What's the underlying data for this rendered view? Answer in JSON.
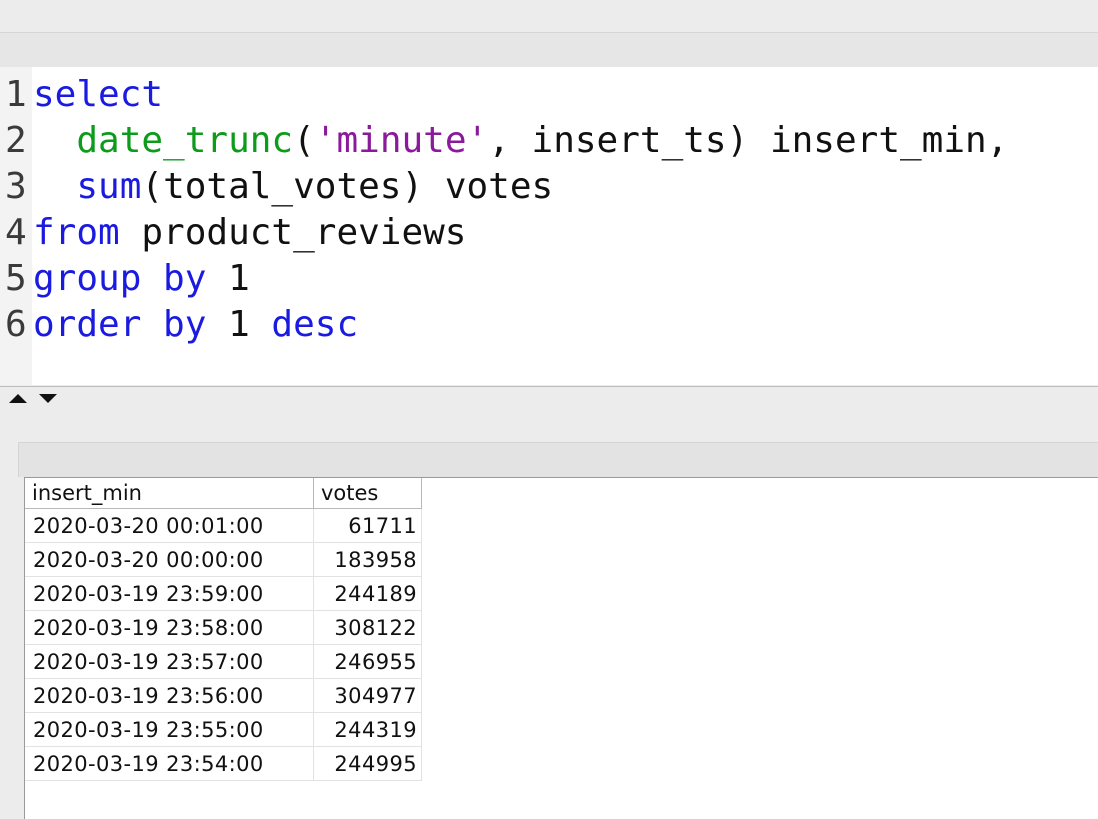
{
  "editor": {
    "lines": [
      {
        "num": "1",
        "tokens": [
          {
            "t": "select",
            "c": "kw"
          }
        ]
      },
      {
        "num": "2",
        "tokens": [
          {
            "t": "  ",
            "c": "plain"
          },
          {
            "t": "date_trunc",
            "c": "fn"
          },
          {
            "t": "(",
            "c": "plain"
          },
          {
            "t": "'minute'",
            "c": "str"
          },
          {
            "t": ", insert_ts) insert_min,",
            "c": "plain"
          }
        ]
      },
      {
        "num": "3",
        "tokens": [
          {
            "t": "  ",
            "c": "plain"
          },
          {
            "t": "sum",
            "c": "kw"
          },
          {
            "t": "(total_votes) votes",
            "c": "plain"
          }
        ]
      },
      {
        "num": "4",
        "tokens": [
          {
            "t": "from",
            "c": "kw"
          },
          {
            "t": " product_reviews",
            "c": "plain"
          }
        ]
      },
      {
        "num": "5",
        "tokens": [
          {
            "t": "group by",
            "c": "kw"
          },
          {
            "t": " 1",
            "c": "plain"
          }
        ]
      },
      {
        "num": "6",
        "tokens": [
          {
            "t": "order by",
            "c": "kw"
          },
          {
            "t": " 1 ",
            "c": "plain"
          },
          {
            "t": "desc",
            "c": "kw"
          }
        ]
      }
    ]
  },
  "colors": {
    "keyword": "#1a1ae0",
    "function": "#0d9b1c",
    "string": "#8a1a9b",
    "text": "#111111"
  },
  "results": {
    "columns": [
      "insert_min",
      "votes"
    ],
    "rows": [
      [
        "2020-03-20 00:01:00",
        "61711"
      ],
      [
        "2020-03-20 00:00:00",
        "183958"
      ],
      [
        "2020-03-19 23:59:00",
        "244189"
      ],
      [
        "2020-03-19 23:58:00",
        "308122"
      ],
      [
        "2020-03-19 23:57:00",
        "246955"
      ],
      [
        "2020-03-19 23:56:00",
        "304977"
      ],
      [
        "2020-03-19 23:55:00",
        "244319"
      ],
      [
        "2020-03-19 23:54:00",
        "244995"
      ]
    ]
  },
  "splitter": {
    "icons": [
      "collapse-up-icon",
      "expand-down-icon"
    ]
  }
}
